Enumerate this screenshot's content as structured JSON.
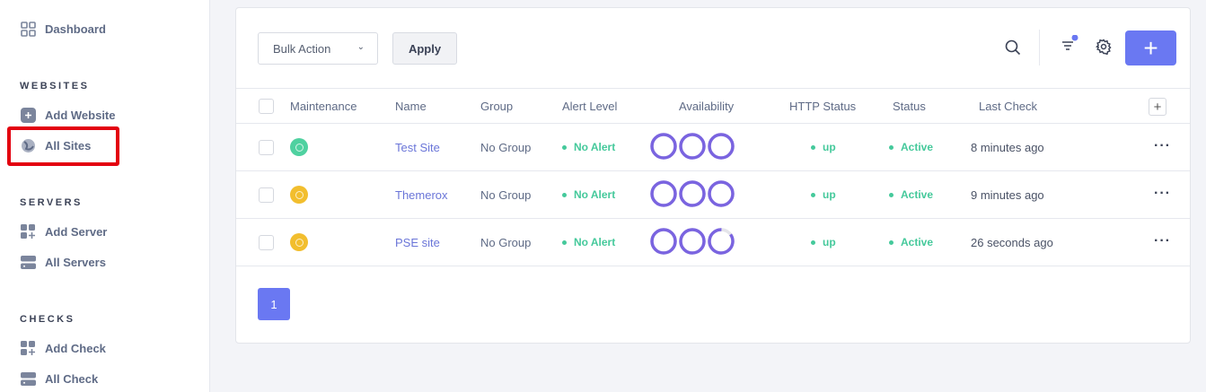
{
  "sidebar": {
    "dashboard": "Dashboard",
    "sections": [
      {
        "title": "WEBSITES",
        "items": [
          "Add Website",
          "All Sites"
        ]
      },
      {
        "title": "SERVERS",
        "items": [
          "Add Server",
          "All Servers"
        ]
      },
      {
        "title": "CHECKS",
        "items": [
          "Add Check",
          "All Check"
        ]
      }
    ]
  },
  "toolbar": {
    "bulk_action": "Bulk Action",
    "apply": "Apply",
    "add": "+"
  },
  "table": {
    "columns": [
      "Maintenance",
      "Name",
      "Group",
      "Alert Level",
      "Availability",
      "HTTP Status",
      "Status",
      "Last Check"
    ],
    "rows": [
      {
        "maintenance_color": "#4fd1a0",
        "name": "Test Site",
        "group": "No Group",
        "alert": "No Alert",
        "availability": [
          100,
          100,
          100
        ],
        "http": "up",
        "status": "Active",
        "last_check": "8 minutes ago"
      },
      {
        "maintenance_color": "#f2be2e",
        "name": "Themerox",
        "group": "No Group",
        "alert": "No Alert",
        "availability": [
          100,
          100,
          100
        ],
        "http": "up",
        "status": "Active",
        "last_check": "9 minutes ago"
      },
      {
        "maintenance_color": "#f2be2e",
        "name": "PSE site",
        "group": "No Group",
        "alert": "No Alert",
        "availability": [
          100,
          100,
          85
        ],
        "http": "up",
        "status": "Active",
        "last_check": "26 seconds ago"
      }
    ]
  },
  "pagination": {
    "current": "1"
  },
  "colors": {
    "accent": "#6a78f2",
    "ring": "#7a64e0",
    "success": "#45c99b",
    "highlight": "#e3000f"
  }
}
